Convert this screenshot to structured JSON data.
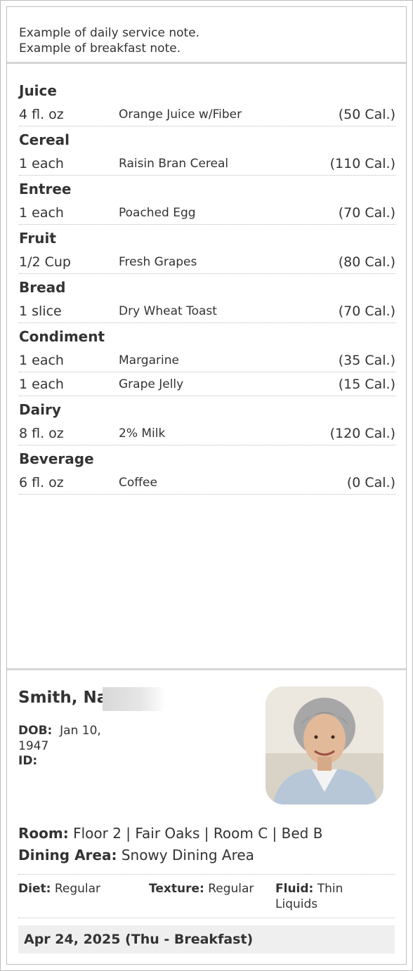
{
  "notes": {
    "line1": "Example of daily service note.",
    "line2": "Example of breakfast note."
  },
  "menu": [
    {
      "category": "Juice",
      "items": [
        {
          "qty": "4 fl. oz",
          "name": "Orange Juice w/Fiber",
          "cal": "(50 Cal.)"
        }
      ]
    },
    {
      "category": "Cereal",
      "items": [
        {
          "qty": "1 each",
          "name": "Raisin Bran Cereal",
          "cal": "(110 Cal.)"
        }
      ]
    },
    {
      "category": "Entree",
      "items": [
        {
          "qty": "1 each",
          "name": "Poached Egg",
          "cal": "(70 Cal.)"
        }
      ]
    },
    {
      "category": "Fruit",
      "items": [
        {
          "qty": "1/2 Cup",
          "name": "Fresh Grapes",
          "cal": "(80 Cal.)"
        }
      ]
    },
    {
      "category": "Bread",
      "items": [
        {
          "qty": "1 slice",
          "name": "Dry Wheat Toast",
          "cal": "(70 Cal.)"
        }
      ]
    },
    {
      "category": "Condiment",
      "items": [
        {
          "qty": "1 each",
          "name": "Margarine",
          "cal": "(35 Cal.)"
        },
        {
          "qty": "1 each",
          "name": "Grape Jelly",
          "cal": "(15 Cal.)"
        }
      ]
    },
    {
      "category": "Dairy",
      "items": [
        {
          "qty": "8 fl. oz",
          "name": "2% Milk",
          "cal": "(120 Cal.)"
        }
      ]
    },
    {
      "category": "Beverage",
      "items": [
        {
          "qty": "6 fl. oz",
          "name": "Coffee",
          "cal": "(0 Cal.)"
        }
      ]
    }
  ],
  "resident": {
    "name": "Smith, Na",
    "dob_label": "DOB:",
    "dob_value": "Jan 10, 1947",
    "id_label": "ID:",
    "id_value": "",
    "room_label": "Room:",
    "room_value": "Floor 2 | Fair Oaks | Room C | Bed B",
    "dining_label": "Dining Area:",
    "dining_value": "Snowy Dining Area",
    "diet_label": "Diet:",
    "diet_value": "Regular",
    "texture_label": "Texture:",
    "texture_value": "Regular",
    "fluid_label": "Fluid:",
    "fluid_value": "Thin Liquids"
  },
  "date_bar": "Apr 24, 2025 (Thu - Breakfast)",
  "colors": {
    "border": "#bdbdbd",
    "separator": "#d6d6d6",
    "text": "#333333",
    "date_bg": "#efefef"
  }
}
